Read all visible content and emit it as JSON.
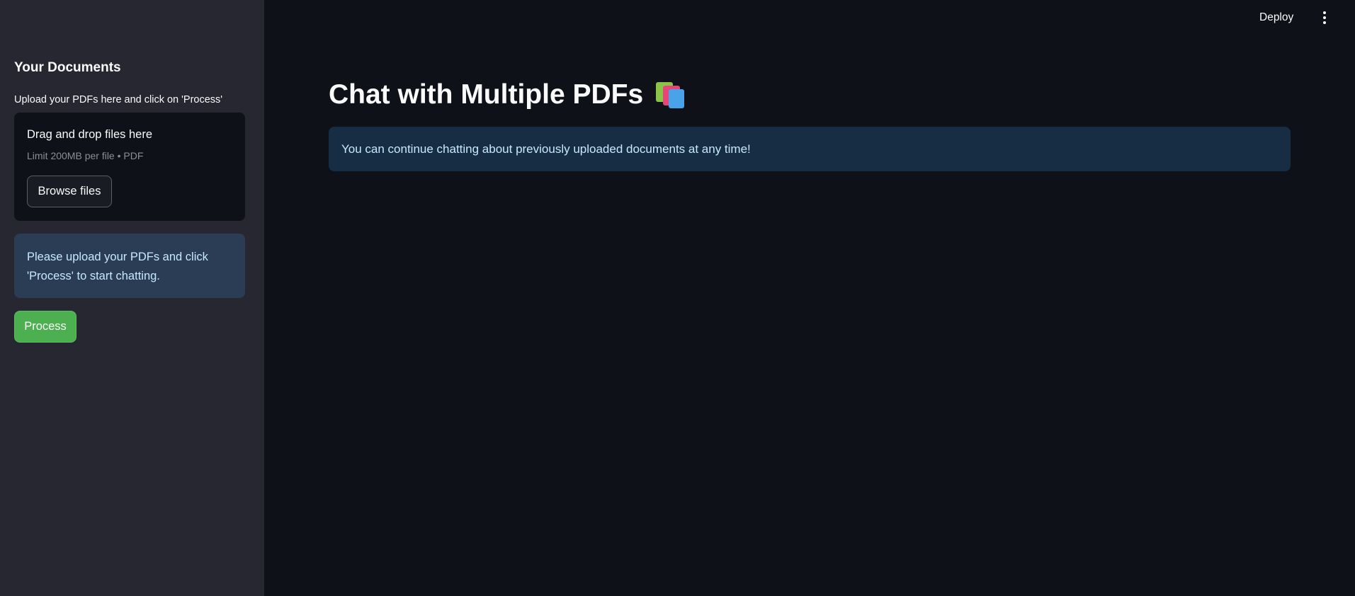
{
  "sidebar": {
    "heading": "Your Documents",
    "upload_label": "Upload your PDFs here and click on 'Process'",
    "dropzone": {
      "title": "Drag and drop files here",
      "limit": "Limit 200MB per file • PDF",
      "browse_label": "Browse files"
    },
    "info_message": "Please upload your PDFs and click 'Process' to start chatting.",
    "process_label": "Process"
  },
  "header": {
    "deploy_label": "Deploy",
    "menu_icon": "vertical-ellipsis-icon"
  },
  "main": {
    "title": "Chat with Multiple PDFs",
    "title_icon": "books-icon",
    "info_message": "You can continue chatting about previously uploaded documents at any time!"
  },
  "colors": {
    "main_bg": "#0e1117",
    "sidebar_bg": "#262730",
    "info_bg": "#172d43",
    "process_button": "#4caf50"
  }
}
